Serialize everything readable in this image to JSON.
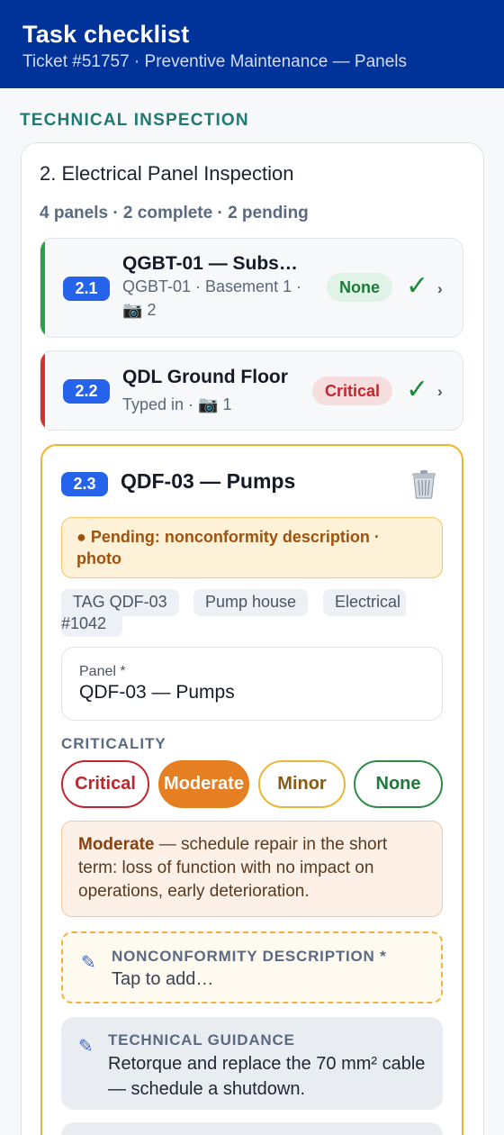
{
  "header": {
    "title": "Task checklist",
    "subtitle": "Ticket #51757 · Preventive Maintenance — Panels"
  },
  "section": {
    "title": "TECHNICAL INSPECTION"
  },
  "task": {
    "title": "2. Electrical Panel Inspection",
    "summary": "4 panels · 2 complete · 2 pending"
  },
  "panels": [
    {
      "number": "2.1",
      "name": "QGBT-01 — Subs…",
      "meta_line1": "QGBT-01 · Basement 1 ·",
      "photo_count": "2",
      "criticality": "None",
      "status_color": "#2e9e4f",
      "completed": true
    },
    {
      "number": "2.2",
      "name": "QDL Ground Floor",
      "meta_line1": "Typed in ·",
      "photo_count": "1",
      "criticality": "Critical",
      "status_color": "#d0342c",
      "completed": true
    }
  ],
  "active_panel": {
    "number": "2.3",
    "name": "QDF-03 — Pumps",
    "pending": "● Pending: nonconformity description · photo",
    "tags": [
      "TAG QDF-03",
      "Pump house",
      "Electrical",
      "#1042"
    ],
    "panel_field": {
      "label": "Panel *",
      "value": "QDF-03 — Pumps"
    },
    "criticality_label": "CRITICALITY",
    "criticality_options": [
      "Critical",
      "Moderate",
      "Minor",
      "None"
    ],
    "criticality_selected": "Moderate",
    "criticality_desc_title": "Moderate",
    "criticality_desc": " — schedule repair in the short term: loss of function with no impact on operations, early deterioration.",
    "nonconformity": {
      "label": "NONCONFORMITY DESCRIPTION *",
      "placeholder": "Tap to add…"
    },
    "guidance": {
      "label": "TECHNICAL GUIDANCE",
      "text": "Retorque and replace the 70 mm² cable — schedule a shutdown."
    }
  },
  "icons": {
    "photo": "camera-icon",
    "done": "checkmark-icon",
    "open": "chevron-right-icon",
    "delete": "trash-icon",
    "edit": "pencil-icon"
  },
  "colors": {
    "header_bg": "#003399",
    "accent_teal": "#1f7a73",
    "badge_blue": "#2563eb",
    "pending_border": "#f0b429",
    "moderate": "#e67e22"
  }
}
